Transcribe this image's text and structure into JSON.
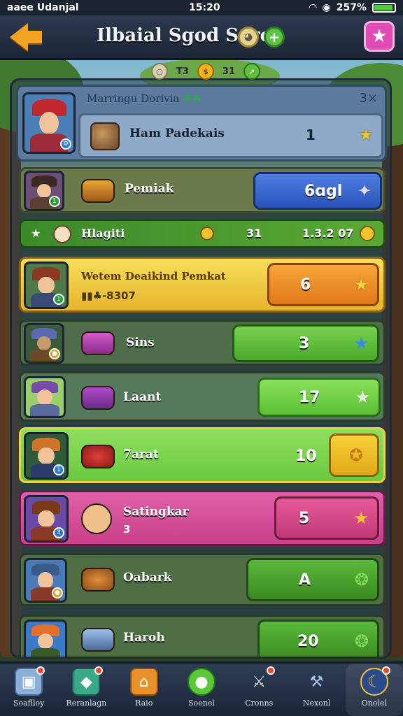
{
  "status": {
    "carrier": "aaee Udanjal",
    "time": "15:20",
    "battery": "257%",
    "battery_level": 0.85
  },
  "header": {
    "title": "Ilbaial Sgod Sare"
  },
  "currency": [
    {
      "icon": "coin-gray-icon",
      "value": ""
    },
    {
      "icon": "coin-gold-icon",
      "value": "T3"
    },
    {
      "icon": "gem-icon",
      "value": "31"
    }
  ],
  "top_card": {
    "label": "Marringu Dorivia",
    "label_suffix": "♣♣",
    "close": "3×",
    "item_name": "Ham Padekais",
    "qty": "1"
  },
  "rows": [
    {
      "name": "Pemiak",
      "sub": "",
      "value": "6ɑgl",
      "color": "blue"
    },
    {
      "name": "Hlagiti",
      "sub": "",
      "value": "31",
      "value2": "1.3.2 07",
      "color": "green-strip"
    },
    {
      "name": "Wetem Deaikind Pemkat",
      "sub": "▮▮♣-8307",
      "value": "6",
      "color": "yellow"
    },
    {
      "name": "Sins",
      "sub": "",
      "value": "3",
      "color": "green"
    },
    {
      "name": "Laant",
      "sub": "",
      "value": "17",
      "color": "lime"
    },
    {
      "name": "7arat",
      "sub": "",
      "value": "10",
      "color": "bright-green"
    },
    {
      "name": "Satingkar",
      "sub": "3",
      "value": "5",
      "color": "pink"
    },
    {
      "name": "Oabark",
      "sub": "",
      "value": "A",
      "color": "green"
    },
    {
      "name": "Haroh",
      "sub": "",
      "value": "20",
      "color": "green"
    }
  ],
  "nav": [
    {
      "label": "Soaflloy",
      "icon": "box-icon"
    },
    {
      "label": "Reranlagn",
      "icon": "cube-icon"
    },
    {
      "label": "Raio",
      "icon": "house-icon"
    },
    {
      "label": "Soenel",
      "icon": "green-orb-icon"
    },
    {
      "label": "Cronns",
      "icon": "swords-icon"
    },
    {
      "label": "Nexonl",
      "icon": "hammer-icon"
    },
    {
      "label": "Onolel",
      "icon": "moon-icon"
    }
  ]
}
